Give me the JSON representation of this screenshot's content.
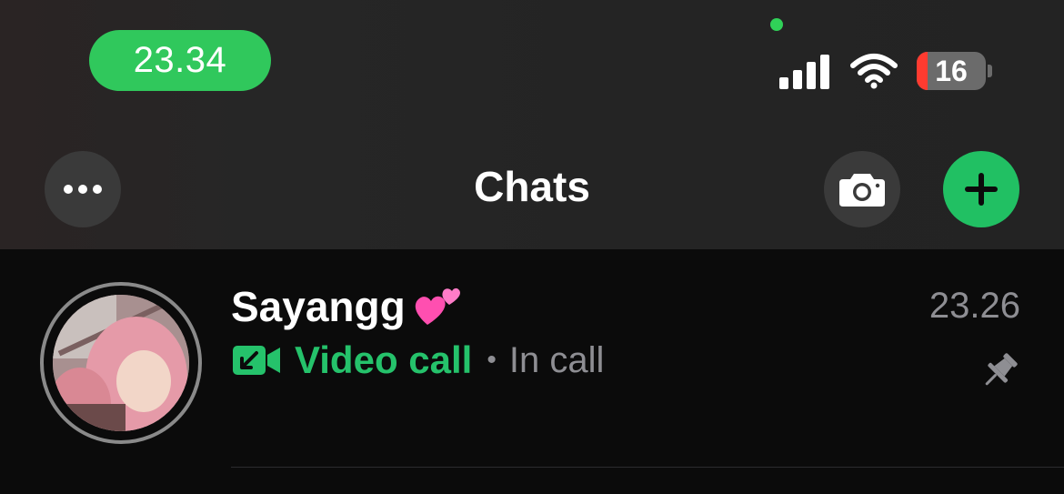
{
  "status_bar": {
    "time": "23.34",
    "battery_level": "16",
    "battery_percent": 16,
    "signal_icon": "cellular-signal-icon",
    "wifi_icon": "wifi-icon",
    "accent_color": "#30c85c"
  },
  "header": {
    "title": "Chats",
    "more_icon": "ellipsis-icon",
    "camera_icon": "camera-icon",
    "new_chat_icon": "plus-icon"
  },
  "chats": [
    {
      "name": "Sayangg",
      "name_emoji_icon": "two-hearts-icon",
      "time": "23.26",
      "call_icon": "video-call-icon",
      "call_type": "Video call",
      "separator": "•",
      "status": "In call",
      "pinned": true,
      "pin_icon": "pin-icon",
      "call_color": "#25c26b"
    }
  ]
}
